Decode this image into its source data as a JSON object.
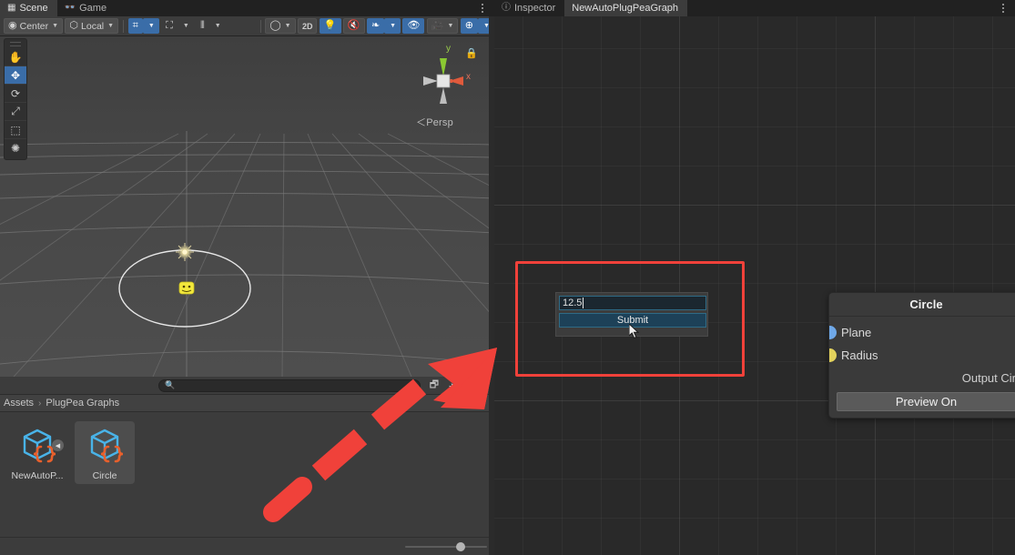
{
  "scene_panel": {
    "tabs": [
      {
        "label": "Scene",
        "icon": "grid-icon",
        "active": true
      },
      {
        "label": "Game",
        "icon": "gamepad-icon",
        "active": false
      }
    ],
    "toolbar": {
      "pivot_mode": "Center",
      "pivot_icon": "pivot-icon",
      "handle_space": "Local",
      "handle_icon": "local-space-icon",
      "grid_snap_icon": "grid-snap-icon",
      "snap_increment_icon": "snap-increment-icon",
      "grid_visibility_icon": "grid-visibility-icon",
      "draw_mode_icon": "shaded-sphere-icon",
      "two_d_label": "2D",
      "lighting_icon": "lightbulb-icon",
      "audio_icon": "audio-mute-icon",
      "fx_icon": "effects-icon",
      "hidden_objects_icon": "eye-off-icon",
      "camera_icon": "camera-icon",
      "scene_vis_icon": "globe-icon"
    },
    "tools": [
      {
        "name": "hand-tool",
        "glyph": "✋",
        "selected": false
      },
      {
        "name": "move-tool",
        "glyph": "✥",
        "selected": true
      },
      {
        "name": "rotate-tool",
        "glyph": "⟳",
        "selected": false
      },
      {
        "name": "scale-tool",
        "glyph": "⤢",
        "selected": false
      },
      {
        "name": "rect-tool",
        "glyph": "⬚",
        "selected": false
      },
      {
        "name": "transform-tool",
        "glyph": "✺",
        "selected": false
      }
    ],
    "gizmo": {
      "axis_y": "y",
      "axis_x": "x",
      "projection_label": "＜Persp",
      "lock_icon": "lock-icon"
    }
  },
  "project_panel": {
    "search_placeholder": "",
    "search_icon": "search-icon",
    "filter_icons": [
      "save-search-icon",
      "type-filter-icon",
      "label-filter-icon"
    ],
    "size_label": "16",
    "breadcrumb": {
      "root": "Assets",
      "separator": "›",
      "current": "PlugPea Graphs"
    },
    "assets": [
      {
        "name": "NewAutoP...",
        "icon": "script-cube-icon",
        "selected": false,
        "has_submenu": true
      },
      {
        "name": "Circle",
        "icon": "script-cube-icon",
        "selected": true,
        "has_submenu": false
      }
    ]
  },
  "graph_panel": {
    "tabs": [
      {
        "label": "Inspector",
        "icon": "info-icon",
        "active": false
      },
      {
        "label": "NewAutoPlugPeaGraph",
        "icon": "",
        "active": true
      }
    ],
    "dialog": {
      "input_value": "12.5",
      "input_placeholder": "",
      "submit_label": "Submit"
    },
    "node": {
      "title": "Circle",
      "inputs": [
        {
          "label": "Plane",
          "color": "#6fa8e8"
        },
        {
          "label": "Radius",
          "color": "#e3d25c"
        }
      ],
      "output_label": "Output Cir",
      "preview_button": "Preview On"
    }
  },
  "annotation": {
    "arrow_color": "#f0413a",
    "highlight_color": "#f0413a"
  }
}
